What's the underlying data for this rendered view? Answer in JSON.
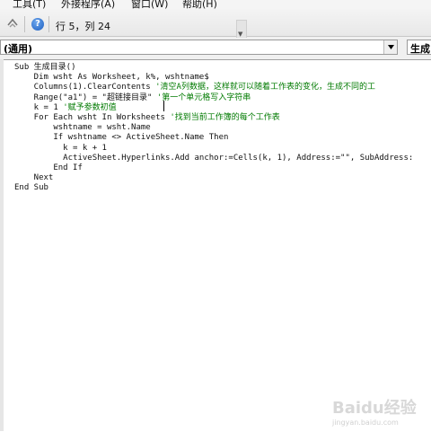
{
  "menu": {
    "items": [
      "工具(T)",
      "外接程序(A)",
      "窗口(W)",
      "帮助(H)"
    ]
  },
  "toolbar": {
    "position_text": "行 5，列 24",
    "icons": [
      "toolbox-icon",
      "help-icon"
    ]
  },
  "combos": {
    "object": "(通用)",
    "procedure": "生成"
  },
  "code": {
    "lines": [
      {
        "code": "Sub 生成目录()",
        "comment": ""
      },
      {
        "code": "    Dim wsht As Worksheet, k%, wshtname$",
        "comment": ""
      },
      {
        "code": "    Columns(1).ClearContents ",
        "comment": "'清空A列数据，这样就可以随着工作表的变化，生成不同的工"
      },
      {
        "code": "    Range(\"a1\") = \"超链接目录\" ",
        "comment": "'第一个单元格写入字符串"
      },
      {
        "code": "    k = 1 ",
        "comment": "'赋予参数初值"
      },
      {
        "code": "    For Each wsht In Worksheets ",
        "comment": "'找到当前工作簿的每个工作表"
      },
      {
        "code": "        wshtname = wsht.Name",
        "comment": ""
      },
      {
        "code": "        If wshtname <> ActiveSheet.Name Then",
        "comment": ""
      },
      {
        "code": "          k = k + 1",
        "comment": ""
      },
      {
        "code": "          ActiveSheet.Hyperlinks.Add anchor:=Cells(k, 1), Address:=\"\", SubAddress:",
        "comment": ""
      },
      {
        "code": "        End If",
        "comment": ""
      },
      {
        "code": "    Next",
        "comment": ""
      },
      {
        "code": "End Sub",
        "comment": ""
      }
    ]
  },
  "watermark": {
    "text": "Baidu经验",
    "sub": "jingyan.baidu.com"
  }
}
